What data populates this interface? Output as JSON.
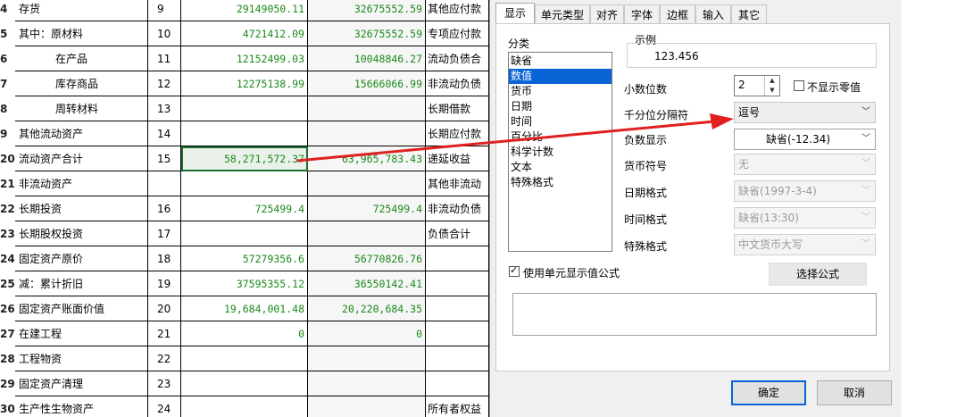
{
  "sheet": {
    "rows": [
      {
        "rn": "4",
        "name": "存货",
        "idx": "9",
        "a": "29149050.11",
        "b": "32675552.59",
        "r": "其他应付款"
      },
      {
        "rn": "5",
        "name": "其中：原材料",
        "idx": "10",
        "a": "4721412.09",
        "b": "32675552.59",
        "r": "专项应付款"
      },
      {
        "rn": "6",
        "name": "在产品",
        "idx": "11",
        "a": "12152499.03",
        "b": "10048846.27",
        "r": "流动负债合"
      },
      {
        "rn": "7",
        "name": "库存商品",
        "idx": "12",
        "a": "12275138.99",
        "b": "15666066.99",
        "r": "非流动负债"
      },
      {
        "rn": "8",
        "name": "周转材料",
        "idx": "13",
        "a": "",
        "b": "",
        "r": "长期借款"
      },
      {
        "rn": "9",
        "name": "其他流动资产",
        "idx": "14",
        "a": "",
        "b": "",
        "r": "长期应付款"
      },
      {
        "rn": "20",
        "name": "流动资产合计",
        "idx": "15",
        "a": "58,271,572.37",
        "b": "63,965,783.43",
        "r": "递延收益"
      },
      {
        "rn": "21",
        "name": "非流动资产",
        "idx": "",
        "a": "",
        "b": "",
        "r": "其他非流动"
      },
      {
        "rn": "22",
        "name": "长期投资",
        "idx": "16",
        "a": "725499.4",
        "b": "725499.4",
        "r": "非流动负债"
      },
      {
        "rn": "23",
        "name": "长期股权投资",
        "idx": "17",
        "a": "",
        "b": "",
        "r": "负债合计"
      },
      {
        "rn": "24",
        "name": "固定资产原价",
        "idx": "18",
        "a": "57279356.6",
        "b": "56770826.76",
        "r": ""
      },
      {
        "rn": "25",
        "name": "减：累计折旧",
        "idx": "19",
        "a": "37595355.12",
        "b": "36550142.41",
        "r": ""
      },
      {
        "rn": "26",
        "name": "固定资产账面价值",
        "idx": "20",
        "a": "19,684,001.48",
        "b": "20,220,684.35",
        "r": ""
      },
      {
        "rn": "27",
        "name": "在建工程",
        "idx": "21",
        "a": "0",
        "b": "0",
        "r": ""
      },
      {
        "rn": "28",
        "name": "工程物资",
        "idx": "22",
        "a": "",
        "b": "",
        "r": ""
      },
      {
        "rn": "29",
        "name": "固定资产清理",
        "idx": "23",
        "a": "",
        "b": "",
        "r": ""
      },
      {
        "rn": "30",
        "name": "生产性生物资产",
        "idx": "24",
        "a": "",
        "b": "",
        "r": "所有者权益"
      }
    ]
  },
  "dialog": {
    "tabs": [
      "显示",
      "单元类型",
      "对齐",
      "字体",
      "边框",
      "输入",
      "其它"
    ],
    "category_label": "分类",
    "categories": [
      "缺省",
      "数值",
      "货币",
      "日期",
      "时间",
      "百分比",
      "科学计数",
      "文本",
      "特殊格式"
    ],
    "selected_category": "数值",
    "sample_label": "示例",
    "sample_value": "123.456",
    "decimals_label": "小数位数",
    "decimals_value": "2",
    "hide_zero_label": "不显示零值",
    "thousand_sep_label": "千分位分隔符",
    "thousand_sep_value": "逗号",
    "negative_label": "负数显示",
    "negative_value": "缺省(-12.34)",
    "currency_label": "货币符号",
    "currency_value": "无",
    "date_label": "日期格式",
    "date_value": "缺省(1997-3-4)",
    "time_label": "时间格式",
    "time_value": "缺省(13:30)",
    "special_label": "特殊格式",
    "special_value": "中文货币大写",
    "use_formula_label": "使用单元显示值公式",
    "choose_formula_label": "选择公式",
    "ok_label": "确定",
    "cancel_label": "取消",
    "accent_color": "#0a64d6",
    "arrow_color": "#e02020"
  }
}
